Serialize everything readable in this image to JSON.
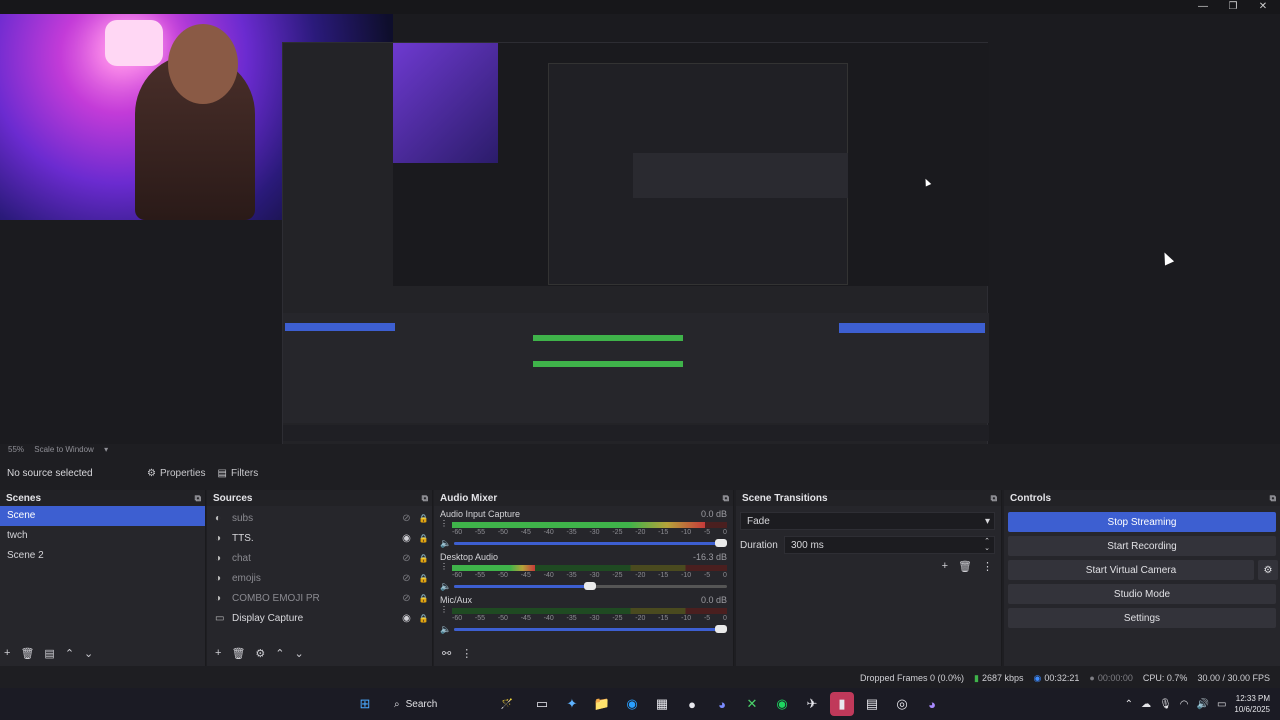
{
  "window": {
    "minimize": "—",
    "maximize": "❐",
    "close": "✕"
  },
  "preview": {
    "zoom": "55%",
    "scale_mode": "Scale to Window"
  },
  "toolbar": {
    "no_source": "No source selected",
    "properties": "Properties",
    "filters": "Filters"
  },
  "scenes": {
    "title": "Scenes",
    "items": [
      "Scene",
      "twch",
      "Scene 2"
    ],
    "selected_index": 0
  },
  "sources": {
    "title": "Sources",
    "items": [
      {
        "label": "subs",
        "icon": "text-icon",
        "visible": false,
        "locked": true
      },
      {
        "label": "TTS.",
        "icon": "browser-icon",
        "visible": true,
        "locked": true
      },
      {
        "label": "chat",
        "icon": "browser-icon",
        "visible": false,
        "locked": true
      },
      {
        "label": "emojis",
        "icon": "browser-icon",
        "visible": false,
        "locked": true
      },
      {
        "label": "COMBO EMOJI PR",
        "icon": "browser-icon",
        "visible": false,
        "locked": true
      },
      {
        "label": "Display Capture",
        "icon": "monitor-icon",
        "visible": true,
        "locked": true
      }
    ]
  },
  "mixer": {
    "title": "Audio Mixer",
    "scale_ticks": [
      "-60",
      "-55",
      "-50",
      "-45",
      "-40",
      "-35",
      "-30",
      "-25",
      "-20",
      "-15",
      "-10",
      "-5",
      "0"
    ],
    "channels": [
      {
        "name": "Audio Input Capture",
        "db": "0.0 dB",
        "level": 0.92,
        "volume": 1.0
      },
      {
        "name": "Desktop Audio",
        "db": "-16.3 dB",
        "level": 0.3,
        "volume": 0.52
      },
      {
        "name": "Mic/Aux",
        "db": "0.0 dB",
        "level": 0.0,
        "volume": 1.0
      }
    ]
  },
  "transitions": {
    "title": "Scene Transitions",
    "selected": "Fade",
    "duration_label": "Duration",
    "duration_value": "300 ms"
  },
  "controls": {
    "title": "Controls",
    "stop_streaming": "Stop Streaming",
    "start_recording": "Start Recording",
    "start_virtual_camera": "Start Virtual Camera",
    "studio_mode": "Studio Mode",
    "settings": "Settings"
  },
  "status": {
    "dropped_frames": "Dropped Frames 0 (0.0%)",
    "bitrate": "2687 kbps",
    "stream_time": "00:32:21",
    "record_time": "00:00:00",
    "cpu": "CPU: 0.7%",
    "fps": "30.00 / 30.00 FPS"
  },
  "taskbar": {
    "search": "Search",
    "time": "12:33 PM",
    "date": "10/6/2025"
  },
  "colors": {
    "accent": "#3d5fd1",
    "meter_green": "#3fb34a",
    "meter_yellow": "#b5a33a",
    "meter_red": "#c73a3a"
  }
}
